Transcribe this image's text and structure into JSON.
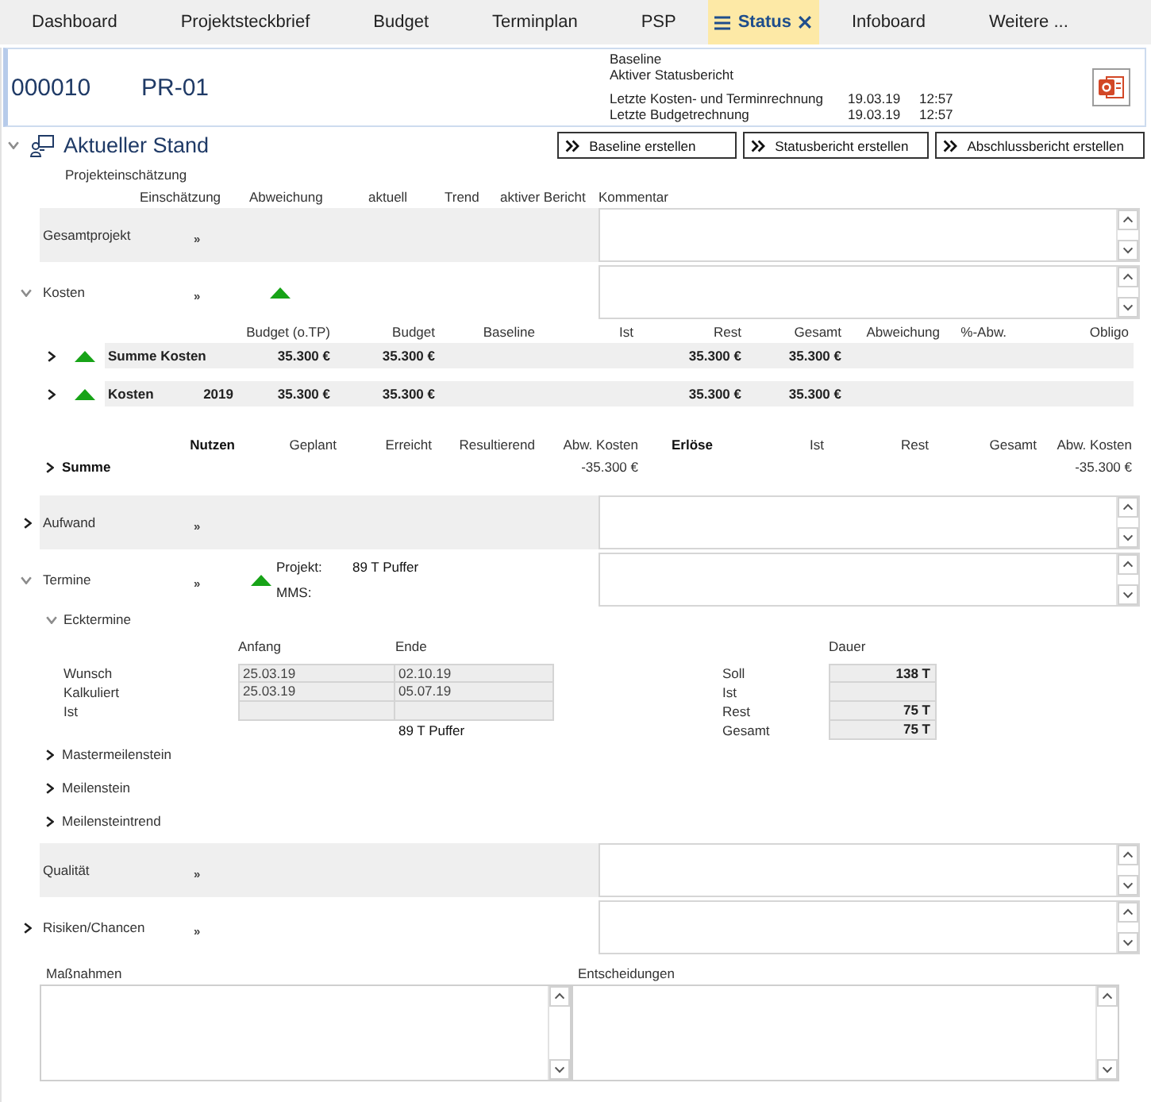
{
  "tabs": [
    {
      "label": "Dashboard",
      "selected": false
    },
    {
      "label": "Projektsteckbrief",
      "selected": false
    },
    {
      "label": "Budget",
      "selected": false
    },
    {
      "label": "Terminplan",
      "selected": false
    },
    {
      "label": "PSP",
      "selected": false
    },
    {
      "label": "Status",
      "selected": true
    },
    {
      "label": "Infoboard",
      "selected": false
    },
    {
      "label": "Weitere ...",
      "selected": false
    }
  ],
  "header": {
    "number": "000010",
    "code": "PR-01",
    "reports": [
      "Baseline",
      "Aktiver Statusbericht"
    ],
    "calculations": [
      {
        "label": "Letzte Kosten- und Terminrechnung",
        "date": "19.03.19",
        "time": "12:57"
      },
      {
        "label": "Letzte Budgetrechnung",
        "date": "19.03.19",
        "time": "12:57"
      }
    ]
  },
  "section": {
    "title": "Aktueller Stand",
    "expanded": true,
    "buttons": [
      "Baseline erstellen",
      "Statusbericht erstellen",
      "Abschlussbericht erstellen"
    ]
  },
  "assessment": {
    "title": "Projekteinschätzung",
    "columns": [
      "Einschätzung",
      "Abweichung",
      "aktuell",
      "Trend",
      "aktiver Bericht",
      "Kommentar"
    ],
    "areas": [
      {
        "label": "Gesamtprojekt",
        "link": "»"
      },
      {
        "label": "Kosten",
        "expanded": true,
        "link": "»",
        "on_track": true,
        "costs": {
          "rows": [
            {
              "label": "Summe Kosten",
              "expanded": false,
              "on_track": true
            },
            {
              "label": "Kosten",
              "year": "2019",
              "expanded": false,
              "on_track": true
            }
          ],
          "columns": [
            {
              "label": "Budget (o.TP)",
              "cells": [
                "35.300 €",
                "35.300 €"
              ]
            },
            {
              "label": "Budget",
              "cells": [
                "35.300 €",
                "35.300 €"
              ]
            },
            {
              "label": "Baseline"
            },
            {
              "label": "Ist"
            },
            {
              "label": "Rest",
              "cells": [
                "35.300 €",
                "35.300 €"
              ]
            },
            {
              "label": "Gesamt",
              "cells": [
                "35.300 €",
                "35.300 €"
              ]
            },
            {
              "label": "Abweichung"
            },
            {
              "label": "%-Abw."
            },
            {
              "label": "Obligo"
            }
          ]
        },
        "benefits": {
          "title": "Nutzen",
          "rows": [
            {
              "label": "Summe",
              "expanded": false
            }
          ],
          "columns": [
            {
              "label": "Geplant",
              "kind": "value"
            },
            {
              "label": "Erreicht",
              "kind": "value"
            },
            {
              "label": "Resultierend",
              "kind": "value"
            },
            {
              "label": "Abw. Kosten",
              "kind": "value",
              "cells": [
                "-35.300 €"
              ]
            },
            {
              "label": "Erlöse",
              "kind": "group"
            },
            {
              "label": "Ist",
              "kind": "value"
            },
            {
              "label": "Rest",
              "kind": "value"
            },
            {
              "label": "Gesamt",
              "kind": "value"
            },
            {
              "label": "Abw. Kosten",
              "kind": "value",
              "cells": [
                "-35.300 €"
              ]
            }
          ]
        }
      },
      {
        "label": "Aufwand",
        "expanded": false,
        "link": "»"
      },
      {
        "label": "Termine",
        "expanded": true,
        "link": "»",
        "on_track": true,
        "schedule": {
          "project_label": "Projekt:",
          "project_value": "89 T Puffer",
          "mms_label": "MMS:"
        },
        "milestones": {
          "title": "Ecktermine",
          "expanded": true,
          "columns": [
            "Anfang",
            "Ende"
          ],
          "rows": [
            {
              "label": "Wunsch",
              "start": "25.03.19",
              "end": "02.10.19"
            },
            {
              "label": "Kalkuliert",
              "start": "25.03.19",
              "end": "05.07.19"
            },
            {
              "label": "Ist"
            }
          ],
          "buffer": "89 T Puffer",
          "duration_title": "Dauer",
          "durations": [
            {
              "label": "Soll",
              "value": "138 T"
            },
            {
              "label": "Ist"
            },
            {
              "label": "Rest",
              "value": "75 T"
            },
            {
              "label": "Gesamt",
              "value": "75 T"
            }
          ]
        },
        "subsections": [
          {
            "label": "Mastermeilenstein",
            "expanded": false
          },
          {
            "label": "Meilenstein",
            "expanded": false
          },
          {
            "label": "Meilensteintrend",
            "expanded": false
          }
        ]
      },
      {
        "label": "Qualität",
        "link": "»"
      },
      {
        "label": "Risiken/Chancen",
        "expanded": false,
        "link": "»"
      }
    ]
  },
  "notes": [
    {
      "label": "Maßnahmen"
    },
    {
      "label": "Entscheidungen"
    }
  ]
}
